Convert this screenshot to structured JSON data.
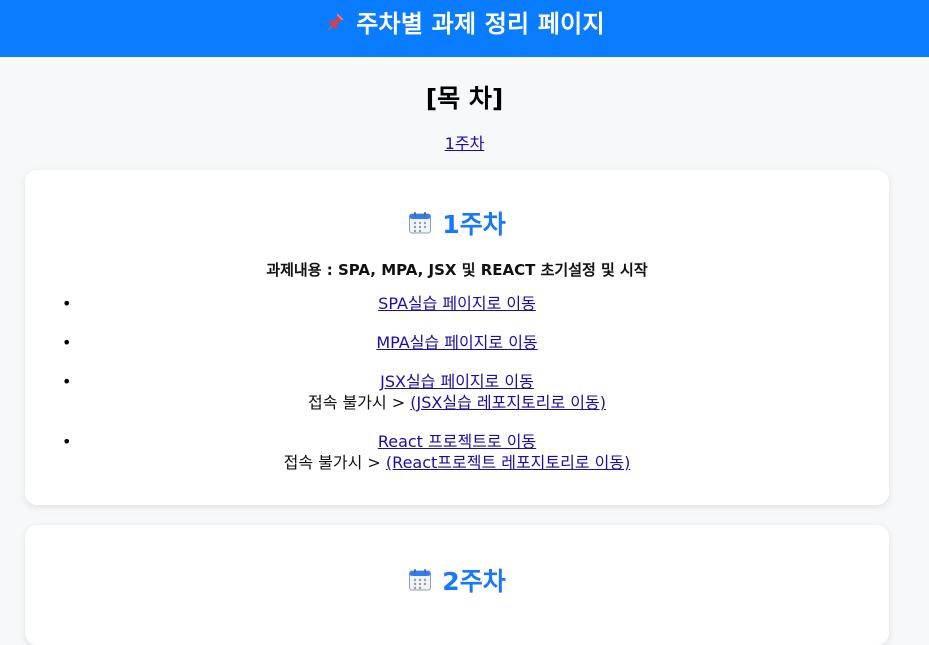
{
  "header": {
    "icon": "pushpin-icon",
    "title": "주차별 과제 정리 페이지"
  },
  "toc": {
    "title": "[목 차]",
    "links": [
      "1주차"
    ]
  },
  "weeks": [
    {
      "icon": "calendar-icon",
      "title": "1주차",
      "description": "과제내용 : SPA, MPA, JSX 및 REACT 초기설정 및 시작",
      "items": [
        {
          "link": "SPA실습 페이지로 이동"
        },
        {
          "link": "MPA실습 페이지로 이동"
        },
        {
          "link": "JSX실습 페이지로 이동",
          "fallback_text": "접속 불가시 > ",
          "fallback_link": "(JSX실습 레포지토리로 이동)"
        },
        {
          "link": "React 프로젝트로 이동",
          "fallback_text": "접속 불가시 > ",
          "fallback_link": "(React프로젝트 레포지토리로 이동)"
        }
      ]
    },
    {
      "icon": "calendar-icon",
      "title": "2주차"
    }
  ],
  "colors": {
    "header_bg": "#0a7cff",
    "week_title": "#1677ff",
    "link": "#1a0dab",
    "page_bg": "#f6f8fa"
  }
}
